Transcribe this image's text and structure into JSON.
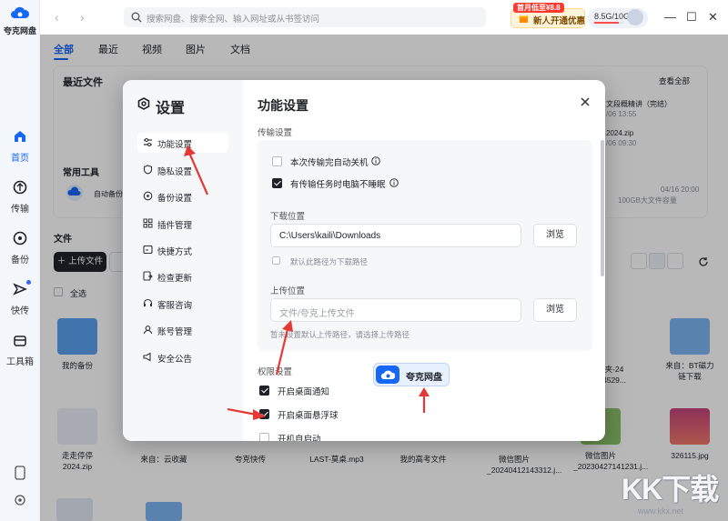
{
  "app": {
    "name": "夸克网盘"
  },
  "rail": {
    "items": [
      {
        "label": "首页",
        "icon": "home-icon",
        "active": true
      },
      {
        "label": "传输",
        "icon": "transfer-icon"
      },
      {
        "label": "备份",
        "icon": "backup-icon"
      },
      {
        "label": "快传",
        "icon": "quick-send-icon"
      },
      {
        "label": "工具箱",
        "icon": "toolbox-icon"
      }
    ]
  },
  "topbar": {
    "search_placeholder": "搜索网盘、搜索全网、输入网址或从书签访问",
    "promo_tag": "首月低至¥8.8",
    "promo_text": "新人开通优惠",
    "storage": "8.5G/10G",
    "storage_used_fraction": 0.85
  },
  "tabs": [
    "全部",
    "最近",
    "视频",
    "图片",
    "文档"
  ],
  "background": {
    "recent_title": "最近文件",
    "common_tools": "常用工具",
    "auto_backup": "自动备份",
    "view_all": "查看全部",
    "recent_right_1": "文段概精讲（完结）",
    "recent_right_1_date": "/06 13:55",
    "recent_right_2": "2024.zip",
    "recent_right_2_date": "/06 09:30",
    "tool_date": "04/16 20:00",
    "tool_desc": "100GB大文件容量",
    "files_title": "文件",
    "upload_label": "上传文件",
    "select_all": "全选",
    "files": [
      {
        "name": "我的备份",
        "kind": "backup"
      },
      {
        "name": "来自：BT磁力链下载",
        "kind": "folder"
      },
      {
        "name": "走走停停2024.zip",
        "kind": "zip"
      },
      {
        "name": "来自：云收藏",
        "kind": "plain"
      },
      {
        "name": "夸克快传",
        "kind": "plain"
      },
      {
        "name": "LAST-莫桌.mp3",
        "kind": "plain"
      },
      {
        "name": "我的高考文件",
        "kind": "plain"
      },
      {
        "name": "微信图片_20240412143312.j...",
        "kind": "plain"
      },
      {
        "name": "微信图片_20230427141231.j...",
        "kind": "flower"
      },
      {
        "name": "326115.jpg",
        "kind": "sunset"
      },
      {
        "name": "夹-24 4529...",
        "kind": "plain"
      }
    ]
  },
  "settings": {
    "title": "设置",
    "nav": [
      {
        "label": "功能设置",
        "icon": "sliders-icon",
        "active": true
      },
      {
        "label": "隐私设置",
        "icon": "shield-icon"
      },
      {
        "label": "备份设置",
        "icon": "backup-icon"
      },
      {
        "label": "插件管理",
        "icon": "grid-icon"
      },
      {
        "label": "快捷方式",
        "icon": "shortcut-icon"
      },
      {
        "label": "检查更新",
        "icon": "update-icon"
      },
      {
        "label": "客服咨询",
        "icon": "headset-icon"
      },
      {
        "label": "账号管理",
        "icon": "account-icon"
      },
      {
        "label": "安全公告",
        "icon": "megaphone-icon"
      }
    ],
    "main_title": "功能设置",
    "transfer_section": "传输设置",
    "opt_shutdown": "本次传输完自动关机",
    "opt_shutdown_checked": false,
    "opt_nosleep": "有传输任务时电脑不睡眠",
    "opt_nosleep_checked": true,
    "download_label": "下载位置",
    "download_path": "C:\\Users\\kaili\\Downloads",
    "browse": "浏览",
    "default_download": "默认此路径为下载路径",
    "upload_label": "上传位置",
    "upload_placeholder": "文件/夸克上传文件",
    "upload_hint": "暂未设置默认上传路径，请选择上传路径",
    "permission_section": "权限设置",
    "opt_desktop_notify": "开启桌面通知",
    "opt_desktop_notify_checked": true,
    "opt_float_ball": "开启桌面悬浮球",
    "opt_float_ball_checked": true,
    "opt_autostart": "开机自启动",
    "opt_autostart_checked": false,
    "float_ball_label": "夸克网盘"
  },
  "watermark": {
    "text": "KK下载",
    "url": "www.kkx.net"
  }
}
